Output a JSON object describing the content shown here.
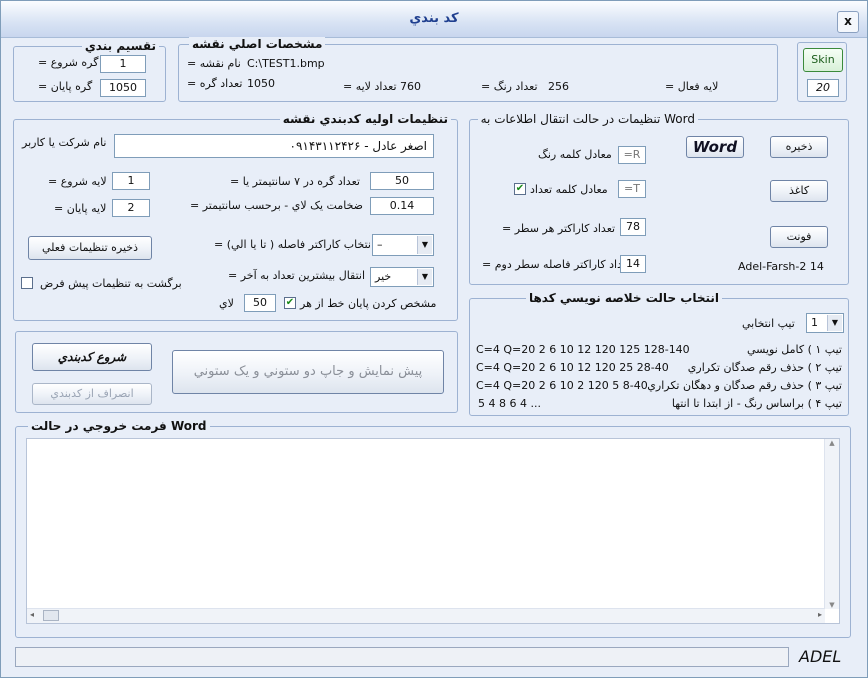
{
  "window": {
    "title": "کد بندي",
    "close_label": "x"
  },
  "division": {
    "legend": "تقسيم بندي",
    "start_label": "= گره شروع",
    "start_value": "1",
    "end_label": "= گره پايان",
    "end_value": "1050"
  },
  "map": {
    "legend": "مشخصات اصلي نقشه",
    "name_label": "= نام نقشه",
    "name_value": "C:\\TEST1.bmp",
    "nodes_label": "= تعداد گره",
    "nodes_value": "1050",
    "layers_label": "= تعداد لايه",
    "layers_value": "760",
    "colors_label": "= تعداد رنگ",
    "colors_value": "256",
    "active_label": "= لايه فعال"
  },
  "skin": {
    "button_label": "Skin",
    "value": "20"
  },
  "initial": {
    "legend": "تنظيمات اوليه كدبندي نقشه",
    "company_label": "نام شركت يا كاربر",
    "company_value": "اصغر عادل - ۰۹۱۴۳۱۱۲۴۲۶",
    "start_layer_label": "= لايه شروع",
    "start_layer_value": "1",
    "end_layer_label": "= لايه پايان",
    "end_layer_value": "2",
    "nodes_7cm_label": "= تعداد گره در ۷ سانتيمتر   يا",
    "nodes_7cm_value": "50",
    "thickness_label": "= ضخامت يک لاي - برحسب سانتيمتر",
    "thickness_value": "0.14",
    "save_button": "ذخيره تنظيمات فعلي",
    "reset_label": "برگشت به تنظيمات پيش فرض",
    "sep_label": "= انتخاب كاراكتر فاصله ( تا يا الي)",
    "sep_value": "–",
    "move_label": "= انتقال بيشترين تعداد به آخر",
    "move_value": "خير",
    "endline_label": "مشخص کردن پايان خط از هر",
    "endline_value": "50",
    "endline_unit": "لاي"
  },
  "word": {
    "legend": "تنظيمات در حالت انتقال اطلاعات به  Word",
    "word_button": "Word",
    "save_button": "ذخيره",
    "paper_button": "كاغذ",
    "font_button": "فونت",
    "color_word_label": "معادل كلمه رنگ",
    "color_word_value": "=R",
    "count_word_label": "معادل كلمه تعداد",
    "count_word_value": "=T",
    "chars_label": "= تعداد كاراكتر هر سطر",
    "chars_value": "78",
    "spacing_label": "= تعداد كاراكتر فاصله سطر دوم",
    "spacing_value": "14",
    "font_info": "Adel-Farsh-2   14"
  },
  "actions": {
    "start_button": "شروع كدبندي",
    "cancel_button": "انصراف از كدبندي",
    "preview_button": "پيش نمايش و جاپ دو ستوني و يک ستوني"
  },
  "summary": {
    "legend": "انتخاب حالت خلاصه نويسي كدها",
    "type_label": "تيپ انتخابي",
    "type_value": "1",
    "types": [
      {
        "label": "تيپ ۱ ) كامل نويسي",
        "sample": "C=4 Q=20   2  6  10  12  120  125  128-140"
      },
      {
        "label": "تيپ ۲ ) حذف رقم صدگان تكراري",
        "sample": "C=4 Q=20  2  6  10  12  120  25  28-40"
      },
      {
        "label": "تيپ ۳ ) حذف رقم صدگان و دهگان تكراري",
        "sample": "C=4 Q=20  2  6  10  2  120  5  8-40"
      },
      {
        "label": "تيپ ۴ ) براساس رنگ - از ابتدا تا انتها",
        "sample": "5  4  8  6  4 ..."
      }
    ]
  },
  "output": {
    "legend": "فرمت خروجي در حالت Word"
  },
  "status": {
    "brand": "ADEL"
  }
}
